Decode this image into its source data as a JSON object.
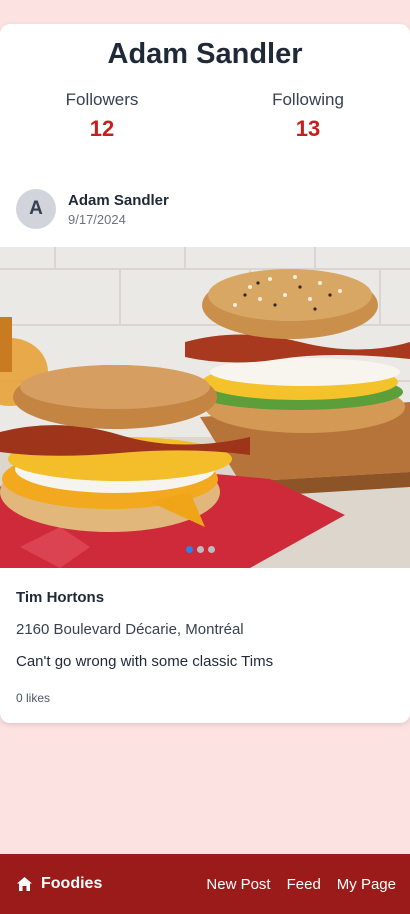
{
  "profile": {
    "name": "Adam Sandler",
    "followers_label": "Followers",
    "followers_count": "12",
    "following_label": "Following",
    "following_count": "13"
  },
  "post": {
    "avatar_initial": "A",
    "author": "Adam Sandler",
    "date": "9/17/2024",
    "image_icon": "food-photo",
    "carousel": {
      "total": 3,
      "active_index": 0
    },
    "place_name": "Tim Hortons",
    "address": "2160 Boulevard Décarie, Montréal",
    "caption": "Can't go wrong with some classic Tims",
    "likes": "0 likes"
  },
  "navbar": {
    "brand_icon": "home-icon",
    "brand": "Foodies",
    "links": [
      "New Post",
      "Feed",
      "My Page"
    ]
  },
  "colors": {
    "page_background": "#fde2e2",
    "navbar": "#9b1b1b",
    "stat_value": "#c81e1e",
    "carousel_active": "#2f80ed"
  }
}
